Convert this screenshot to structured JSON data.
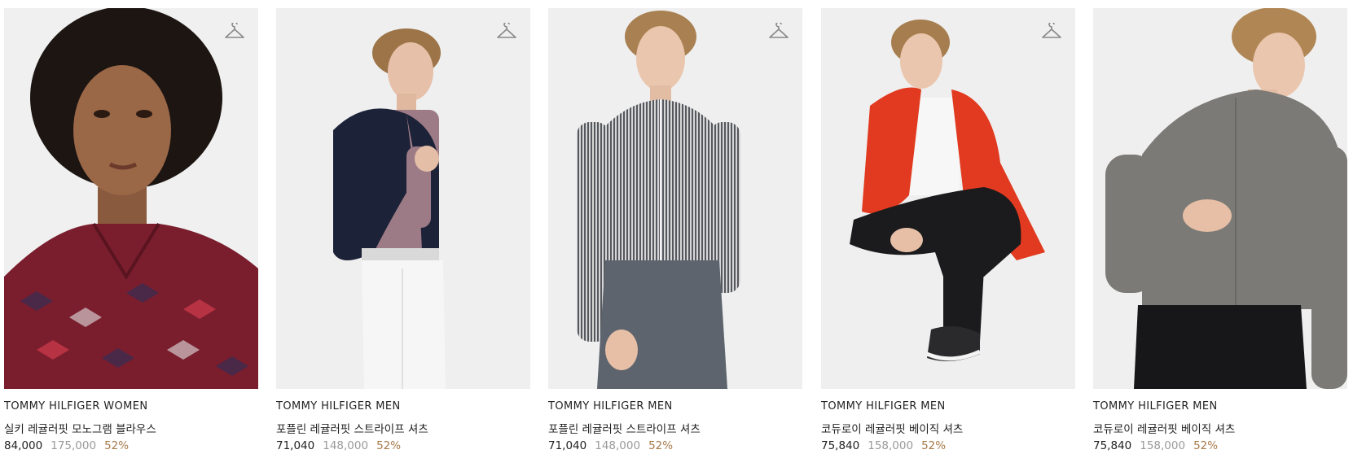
{
  "products": [
    {
      "brand": "TOMMY HILFIGER WOMEN",
      "name": "실키 레귤러핏 모노그램 블라우스",
      "price": "84,000",
      "original_price": "175,000",
      "discount": "52%",
      "show_hanger": true,
      "hanger_icon": "hanger-icon"
    },
    {
      "brand": "TOMMY HILFIGER MEN",
      "name": "포플린 레귤러핏 스트라이프 셔츠",
      "price": "71,040",
      "original_price": "148,000",
      "discount": "52%",
      "show_hanger": true,
      "hanger_icon": "hanger-icon"
    },
    {
      "brand": "TOMMY HILFIGER MEN",
      "name": "포플린 레귤러핏 스트라이프 셔츠",
      "price": "71,040",
      "original_price": "148,000",
      "discount": "52%",
      "show_hanger": true,
      "hanger_icon": "hanger-icon"
    },
    {
      "brand": "TOMMY HILFIGER MEN",
      "name": "코듀로이 레귤러핏 베이직 셔츠",
      "price": "75,840",
      "original_price": "158,000",
      "discount": "52%",
      "show_hanger": true,
      "hanger_icon": "hanger-icon"
    },
    {
      "brand": "TOMMY HILFIGER MEN",
      "name": "코듀로이 레귤러핏 베이직 셔츠",
      "price": "75,840",
      "original_price": "158,000",
      "discount": "52%",
      "show_hanger": false,
      "hanger_icon": "hanger-icon"
    }
  ],
  "colors": {
    "price": "#222222",
    "original_price": "#9a9a9a",
    "discount": "#a87a4a",
    "image_background": "#efefef"
  }
}
